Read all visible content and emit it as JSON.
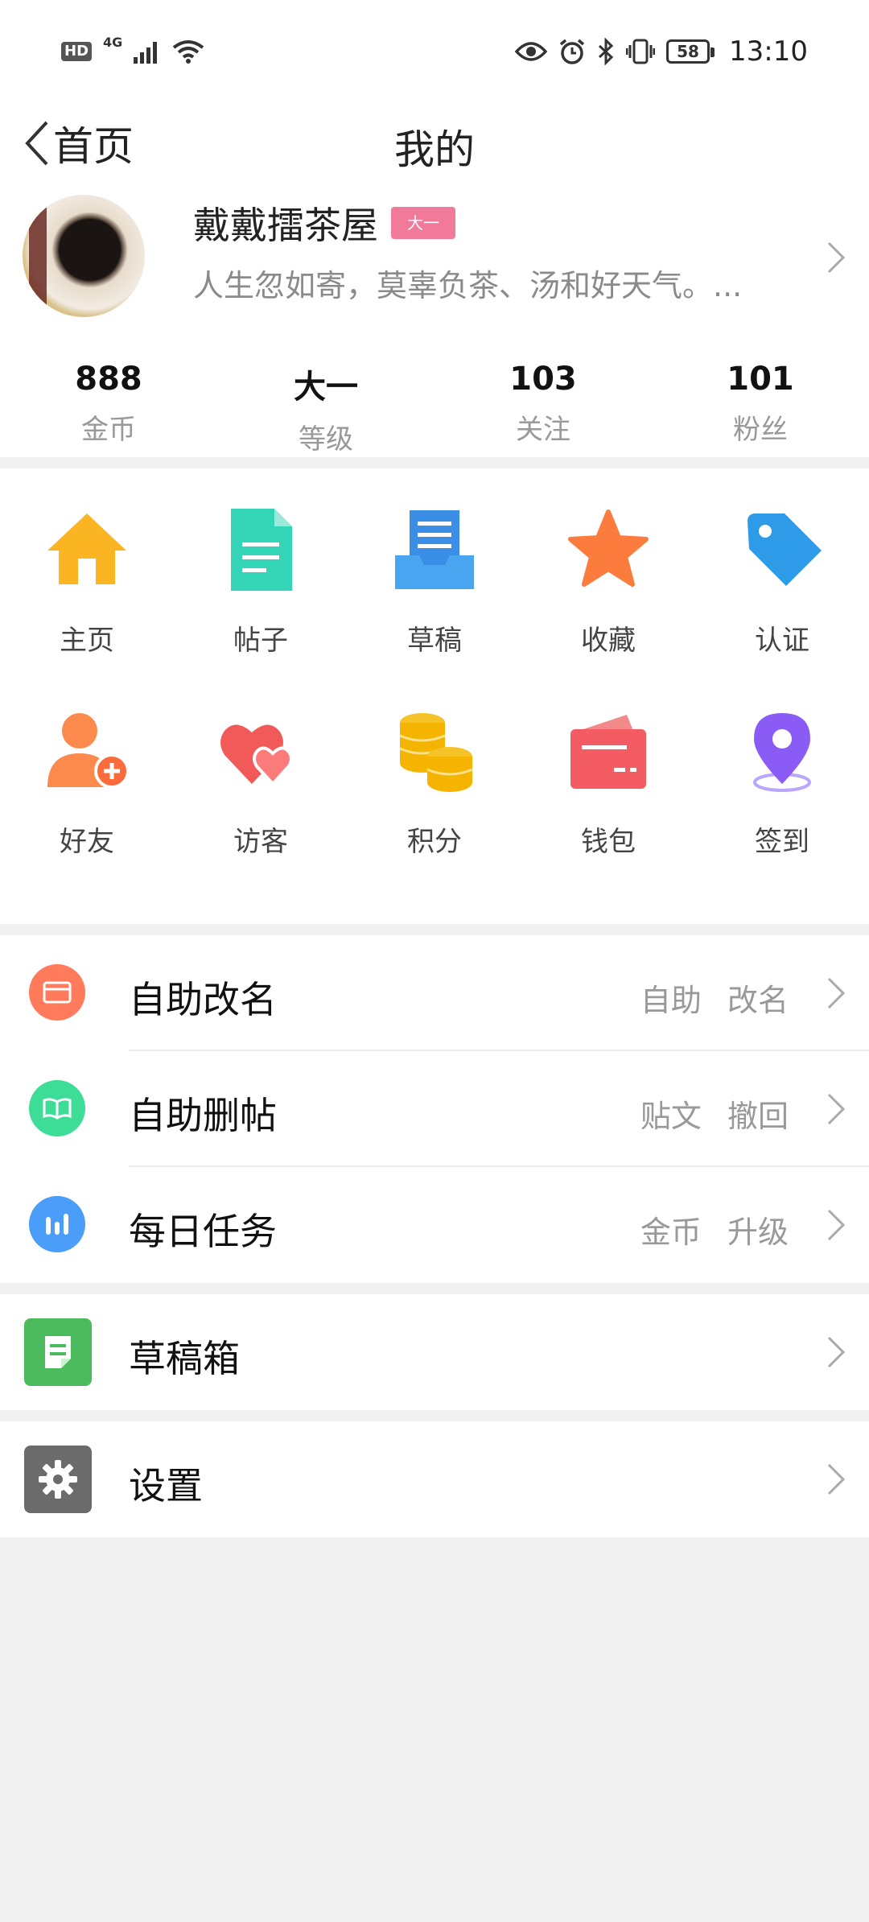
{
  "status_bar": {
    "hd": "HD",
    "network": "4G",
    "battery": "58",
    "time": "13:10"
  },
  "nav": {
    "back_label": "首页",
    "title": "我的"
  },
  "profile": {
    "name": "戴戴擂茶屋",
    "level_badge": "大一",
    "bio": "人生忽如寄，莫辜负茶、汤和好天气。..."
  },
  "stats": [
    {
      "value": "888",
      "label": "金币"
    },
    {
      "value": "大一",
      "label": "等级"
    },
    {
      "value": "103",
      "label": "关注"
    },
    {
      "value": "101",
      "label": "粉丝"
    }
  ],
  "grid": [
    {
      "label": "主页",
      "icon": "home-icon"
    },
    {
      "label": "帖子",
      "icon": "document-icon"
    },
    {
      "label": "草稿",
      "icon": "draft-tray-icon"
    },
    {
      "label": "收藏",
      "icon": "star-icon"
    },
    {
      "label": "认证",
      "icon": "tag-icon"
    },
    {
      "label": "好友",
      "icon": "add-friend-icon"
    },
    {
      "label": "访客",
      "icon": "hearts-icon"
    },
    {
      "label": "积分",
      "icon": "coins-icon"
    },
    {
      "label": "钱包",
      "icon": "wallet-icon"
    },
    {
      "label": "签到",
      "icon": "location-pin-icon"
    }
  ],
  "list_group1": [
    {
      "title": "自助改名",
      "sub": "自助 改名",
      "icon": "card-icon",
      "color": "#ff7b5c"
    },
    {
      "title": "自助删帖",
      "sub": "贴文 撤回",
      "icon": "book-icon",
      "color": "#3ddc97"
    },
    {
      "title": "每日任务",
      "sub": "金币 升级",
      "icon": "bar-chart-icon",
      "color": "#4a9df8"
    }
  ],
  "list_group2": {
    "title": "草稿箱",
    "icon": "note-icon",
    "color": "#4cbb5e"
  },
  "list_group3": {
    "title": "设置",
    "icon": "gear-icon",
    "color": "#6b6b6b"
  }
}
